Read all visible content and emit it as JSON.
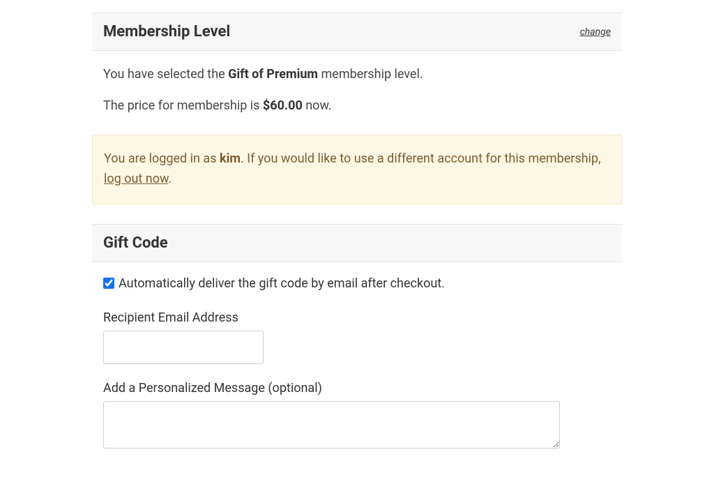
{
  "membership": {
    "header_title": "Membership Level",
    "change_link": "change",
    "selected_prefix": "You have selected the ",
    "selected_level": "Gift of Premium",
    "selected_suffix": " membership level.",
    "price_prefix": "The price for membership is ",
    "price_value": "$60.00",
    "price_suffix": " now."
  },
  "notice": {
    "prefix": "You are logged in as ",
    "username": "kim",
    "middle": ". If you would like to use a different account for this membership, ",
    "logout_link": "log out now",
    "suffix": "."
  },
  "gift": {
    "header_title": "Gift Code",
    "auto_deliver_label": "Automatically deliver the gift code by email after checkout.",
    "auto_deliver_checked": true,
    "recipient_label": "Recipient Email Address",
    "recipient_value": "",
    "message_label": "Add a Personalized Message (optional)",
    "message_value": ""
  }
}
